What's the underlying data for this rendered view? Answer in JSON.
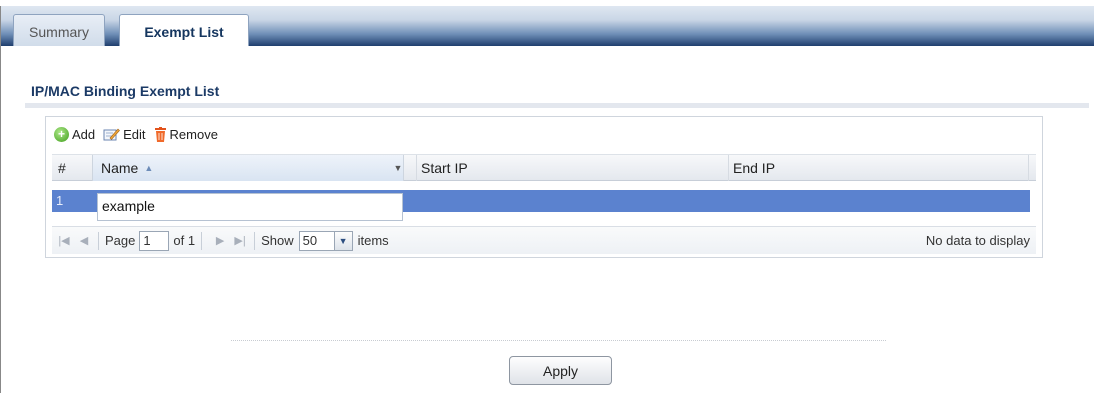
{
  "tabs": [
    {
      "label": "Summary",
      "active": false
    },
    {
      "label": "Exempt List",
      "active": true
    }
  ],
  "section": {
    "title": "IP/MAC Binding Exempt List"
  },
  "toolbar": {
    "add_label": "Add",
    "edit_label": "Edit",
    "remove_label": "Remove"
  },
  "table": {
    "columns": [
      "#",
      "Name",
      "Start IP",
      "End IP"
    ],
    "sorted_column": "Name",
    "rows": [
      {
        "num": "1",
        "name": "example",
        "start_ip": "",
        "end_ip": ""
      }
    ]
  },
  "pager": {
    "page_label": "Page",
    "page_value": "1",
    "of_label": "of 1",
    "show_label": "Show",
    "show_value": "50",
    "items_label": "items",
    "status": "No data to display"
  },
  "apply_label": "Apply",
  "colors": {
    "selected_row": "#5b82cf",
    "title": "#1b3a66",
    "tabbar_dark": "#1f3e6e"
  }
}
